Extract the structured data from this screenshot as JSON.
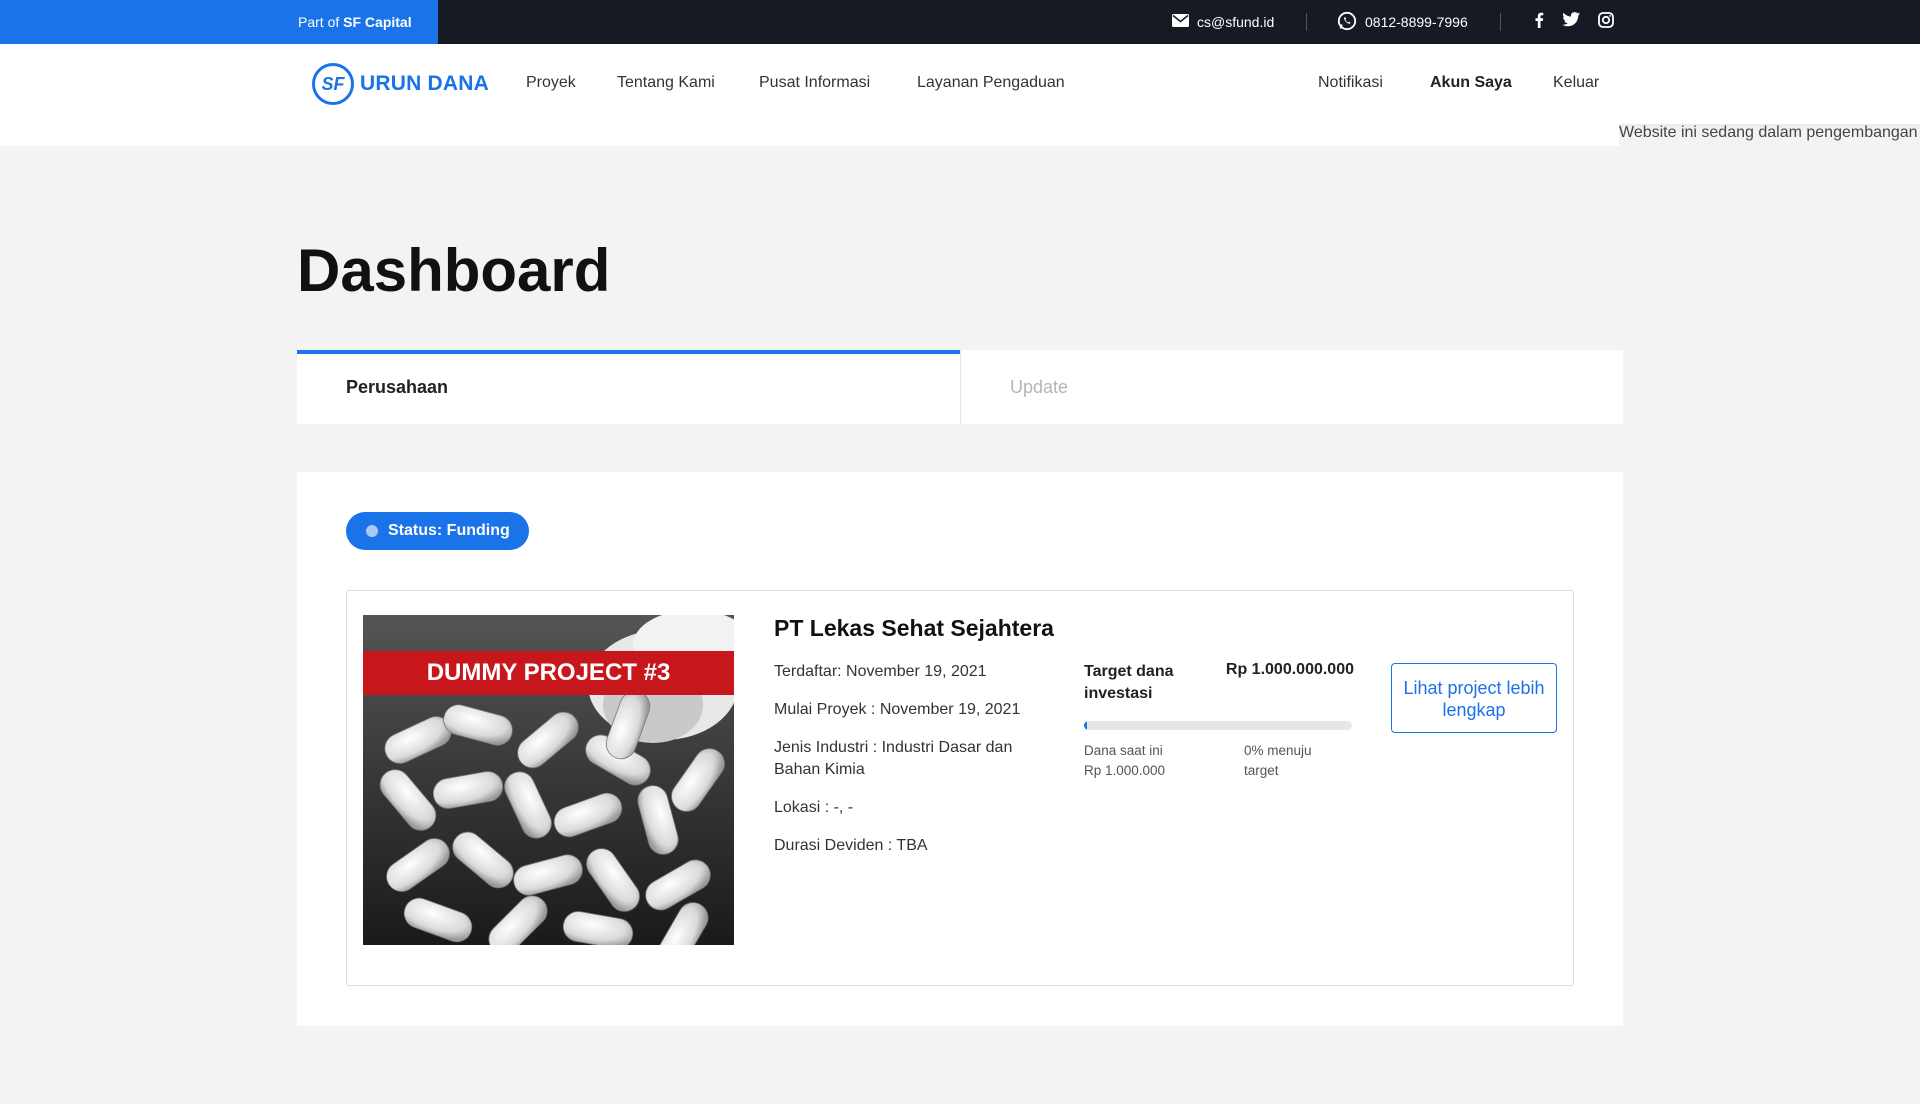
{
  "topbar": {
    "part_of_prefix": "Part of ",
    "part_of_brand": "SF Capital",
    "email": "cs@sfund.id",
    "phone": "0812-8899-7996"
  },
  "nav": {
    "logo_mark": "SF",
    "brand": "URUN DANA",
    "links": [
      "Proyek",
      "Tentang Kami",
      "Pusat Informasi",
      "Layanan Pengaduan"
    ],
    "right_links": [
      "Notifikasi",
      "Akun Saya",
      "Keluar"
    ]
  },
  "dev_note": "Website ini sedang dalam pengembangan",
  "page_title": "Dashboard",
  "tabs": [
    "Perusahaan",
    "Update"
  ],
  "status": "Status: Funding",
  "project": {
    "image_banner": "DUMMY PROJECT #3",
    "name": "PT Lekas Sehat Sejahtera",
    "terdaftar": "Terdaftar: November 19, 2021",
    "mulai": "Mulai Proyek : November 19, 2021",
    "industri": "Jenis Industri : Industri Dasar dan Bahan Kimia",
    "lokasi": "Lokasi : -, -",
    "durasi": "Durasi Deviden : TBA",
    "target_label": "Target dana investasi",
    "target_amount": "Rp 1.000.000.000",
    "progress_fraction": 0.01,
    "current_label": "Dana saat ini",
    "current_amount": "Rp 1.000.000",
    "percent_label": "0% menuju target",
    "more_button": "Lihat project lebih lengkap"
  },
  "colors": {
    "accent": "#1a73e8",
    "topbar": "#161a22",
    "banner_red": "#c8161d"
  }
}
